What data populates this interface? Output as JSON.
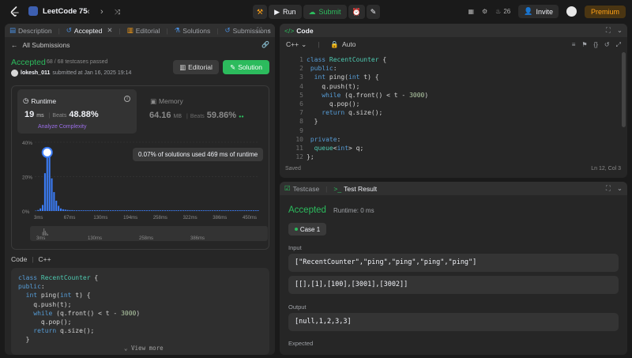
{
  "topbar": {
    "problem_list_title": "LeetCode 75",
    "run_label": "Run",
    "submit_label": "Submit",
    "streak_count": "26",
    "invite_label": "Invite",
    "premium_label": "Premium"
  },
  "left_tabs": {
    "description": "Description",
    "accepted": "Accepted",
    "editorial": "Editorial",
    "solutions": "Solutions",
    "submissions": "Submissions"
  },
  "submission": {
    "back_label": "All Submissions",
    "status": "Accepted",
    "passed": "68 / 68 testcases passed",
    "author": "lokesh_011",
    "submitted_text": "submitted at Jan 16, 2025 19:14",
    "editorial_btn": "Editorial",
    "solution_btn": "Solution"
  },
  "runtime": {
    "label": "Runtime",
    "value": "19",
    "unit": "ms",
    "beats_label": "Beats",
    "beats_value": "48.88%",
    "analyze": "Analyze Complexity"
  },
  "memory": {
    "label": "Memory",
    "value": "64.16",
    "unit": "MB",
    "beats_label": "Beats",
    "beats_value": "59.86%"
  },
  "tooltip": "0.07% of solutions used 469 ms of runtime",
  "chart_data": {
    "type": "bar",
    "y_ticks": [
      "40%",
      "20%",
      "0%"
    ],
    "ylim": [
      0,
      40
    ],
    "x_ticks": [
      "3ms",
      "67ms",
      "130ms",
      "194ms",
      "258ms",
      "322ms",
      "386ms",
      "450ms"
    ],
    "mini_x_ticks": [
      "3ms",
      "130ms",
      "258ms",
      "386ms"
    ],
    "values": [
      0.2,
      0.6,
      1.5,
      3.5,
      22,
      35,
      33,
      19,
      11,
      6,
      3,
      1.5,
      1,
      0.8,
      0.6,
      0.5,
      0.5,
      0.4,
      0.4,
      0.4,
      0.4,
      0.4,
      0.4,
      0.4,
      0.4,
      0.4,
      0.4,
      0.4,
      0.4,
      0.4,
      0.4,
      0.4,
      0.4,
      0.4,
      0.4,
      0.4,
      0.4,
      0.4,
      0.4,
      0.4,
      0.4,
      0.4,
      0.4,
      0.4,
      0.4,
      0.4,
      0.4,
      0.4,
      0.4,
      0.4,
      0.4,
      0.4,
      0.4,
      0.4,
      0.4,
      0.4,
      0.4,
      0.4,
      0.4,
      0.4,
      0.4,
      0.4,
      0.4,
      0.4,
      0.4,
      0.4,
      0.4,
      0.4,
      0.4,
      0.4,
      0.4,
      0.4,
      0.4,
      0.4,
      0.4,
      0.4,
      0.4,
      0.4,
      0.4,
      0.4,
      0.4,
      0.4,
      0.4,
      0.4,
      0.4,
      0.4,
      0.4,
      0.4,
      0.4,
      0.4,
      0.4,
      0.4,
      0.4,
      0.4,
      0.4,
      0.4,
      0.4,
      0.4,
      0.4
    ],
    "highlight_index": 5,
    "accent": "#3b7cf5"
  },
  "code_section": {
    "label": "Code",
    "language": "C++",
    "lines": [
      "class RecentCounter {",
      "public:",
      "  int ping(int t) {",
      "    q.push(t);",
      "    while (q.front() < t - 3000)",
      "      q.pop();",
      "    return q.size();",
      "  }"
    ],
    "view_more": "View more"
  },
  "editor": {
    "tab_label": "Code",
    "language": "C++",
    "mode": "Auto",
    "line_numbers": [
      "1",
      "2",
      "3",
      "4",
      "5",
      "6",
      "7",
      "8",
      "9",
      "10",
      "11",
      "12"
    ],
    "lines": [
      "class RecentCounter {",
      " public:",
      "  int ping(int t) {",
      "    q.push(t);",
      "    while (q.front() < t - 3000)",
      "      q.pop();",
      "    return q.size();",
      "  }",
      "",
      " private:",
      "  queue<int> q;",
      "};"
    ],
    "saved_label": "Saved",
    "cursor_pos": "Ln 12, Col 3"
  },
  "test_panel": {
    "testcase_tab": "Testcase",
    "result_tab": "Test Result",
    "status": "Accepted",
    "runtime_text": "Runtime: 0 ms",
    "case_label": "Case 1",
    "input_label": "Input",
    "input_line1": "[\"RecentCounter\",\"ping\",\"ping\",\"ping\",\"ping\"]",
    "input_line2": "[[],[1],[100],[3001],[3002]]",
    "output_label": "Output",
    "output_value": "[null,1,2,3,3]",
    "expected_label": "Expected"
  }
}
